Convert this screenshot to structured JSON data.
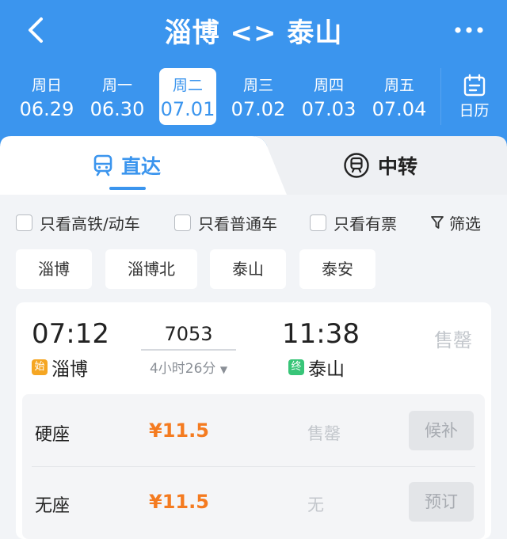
{
  "header": {
    "title": "淄博 <> 泰山",
    "back_icon": "chevron-left-icon",
    "more_icon": "more-dots-icon"
  },
  "dates": [
    {
      "weekday": "周日",
      "date": "06.29"
    },
    {
      "weekday": "周一",
      "date": "06.30"
    },
    {
      "weekday": "周二",
      "date": "07.01",
      "selected": true
    },
    {
      "weekday": "周三",
      "date": "07.02"
    },
    {
      "weekday": "周四",
      "date": "07.03"
    },
    {
      "weekday": "周五",
      "date": "07.04"
    }
  ],
  "calendar": {
    "label": "日历",
    "icon": "calendar-icon"
  },
  "tabs": {
    "direct": {
      "label": "直达",
      "icon": "train-icon",
      "active": true
    },
    "transfer": {
      "label": "中转",
      "icon": "transfer-train-icon"
    }
  },
  "filters": {
    "high_speed_only": "只看高铁/动车",
    "regular_only": "只看普通车",
    "available_only": "只看有票",
    "filter_label": "筛选"
  },
  "stations": [
    "淄博",
    "淄博北",
    "泰山",
    "泰安"
  ],
  "train": {
    "departure_time": "07:12",
    "arrival_time": "11:38",
    "train_number": "7053",
    "duration": "4小时26分",
    "status": "售罄",
    "from_badge": "始",
    "from_station": "淄博",
    "to_badge": "终",
    "to_station": "泰山",
    "seats": [
      {
        "name": "硬座",
        "price": "¥11.5",
        "availability": "售罄",
        "action": "候补"
      },
      {
        "name": "无座",
        "price": "¥11.5",
        "availability": "无",
        "action": "预订"
      }
    ]
  },
  "colors": {
    "primary": "#3b95ee",
    "price": "#f47b20",
    "start_badge": "#f5a623",
    "end_badge": "#38c578"
  }
}
